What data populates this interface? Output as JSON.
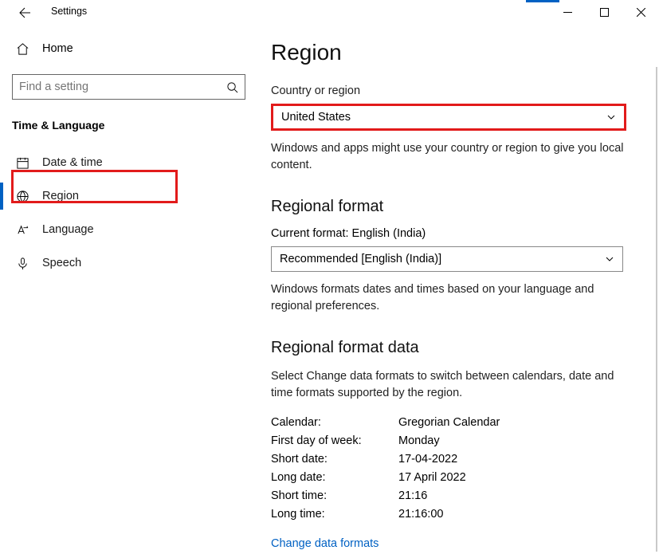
{
  "titlebar": {
    "title": "Settings"
  },
  "sidebar": {
    "home_label": "Home",
    "search_placeholder": "Find a setting",
    "group_title": "Time & Language",
    "items": [
      {
        "label": "Date & time"
      },
      {
        "label": "Region"
      },
      {
        "label": "Language"
      },
      {
        "label": "Speech"
      }
    ]
  },
  "main": {
    "title": "Region",
    "country_label": "Country or region",
    "country_value": "United States",
    "country_note": "Windows and apps might use your country or region to give you local content.",
    "format_heading": "Regional format",
    "current_format": "Current format: English (India)",
    "format_value": "Recommended [English (India)]",
    "format_note": "Windows formats dates and times based on your language and regional preferences.",
    "data_heading": "Regional format data",
    "data_note": "Select Change data formats to switch between calendars, date and time formats supported by the region.",
    "rows": [
      {
        "k": "Calendar:",
        "v": "Gregorian Calendar"
      },
      {
        "k": "First day of week:",
        "v": "Monday"
      },
      {
        "k": "Short date:",
        "v": "17-04-2022"
      },
      {
        "k": "Long date:",
        "v": "17 April 2022"
      },
      {
        "k": "Short time:",
        "v": "21:16"
      },
      {
        "k": "Long time:",
        "v": "21:16:00"
      }
    ],
    "change_link": "Change data formats"
  }
}
